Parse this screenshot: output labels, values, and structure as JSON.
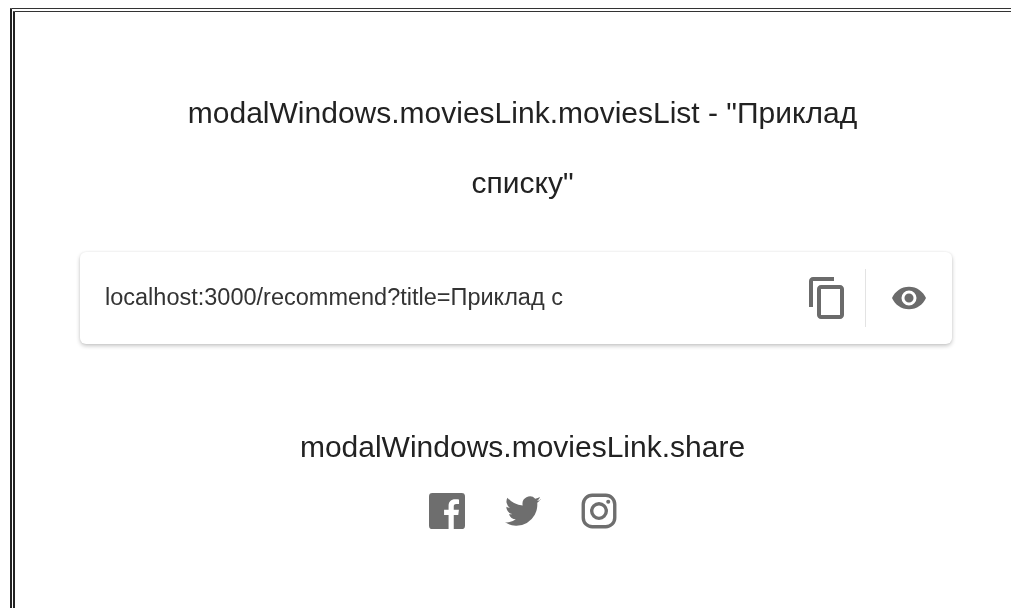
{
  "modal": {
    "title": "modalWindows.moviesLink.moviesList - \"Приклад списку\"",
    "link": {
      "value": "localhost:3000/recommend?title=Приклад с"
    },
    "share_title": "modalWindows.moviesLink.share",
    "share_links": [
      {
        "kind": "facebook"
      },
      {
        "kind": "twitter"
      },
      {
        "kind": "instagram"
      }
    ]
  }
}
